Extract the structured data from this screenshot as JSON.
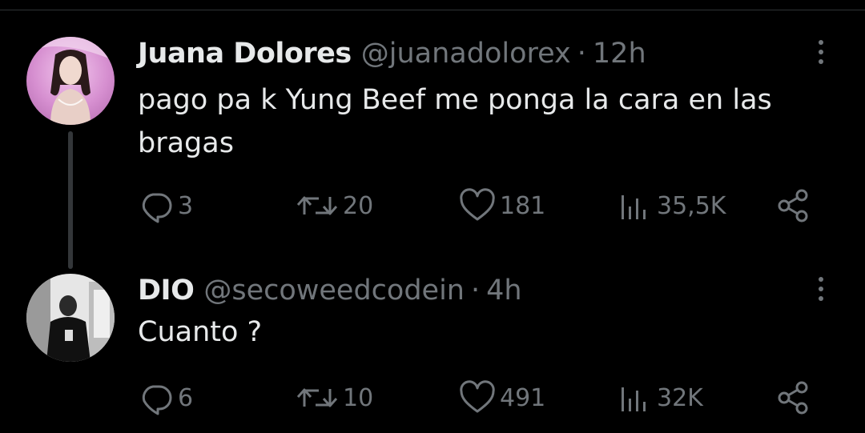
{
  "tweets": [
    {
      "name": "Juana Dolores",
      "handle": "@juanadolorex",
      "separator": "·",
      "time": "12h",
      "text": "pago pa k Yung Beef me ponga la cara en las bragas",
      "replies": "3",
      "retweets": "20",
      "likes": "181",
      "views": "35,5K",
      "avatar_color": "#d9a8d6"
    },
    {
      "name": "DIO",
      "handle": "@secoweedcodein",
      "separator": "·",
      "time": "4h",
      "text": "Cuanto ?",
      "replies": "6",
      "retweets": "10",
      "likes": "491",
      "views": "32K",
      "avatar_color": "#d0d0d0"
    }
  ],
  "icons": {
    "reply": "reply-icon",
    "retweet": "retweet-icon",
    "like": "heart-icon",
    "views": "views-icon",
    "share": "share-icon",
    "more": "more-icon"
  },
  "colors": {
    "background": "#000000",
    "primary_text": "#e7e9ea",
    "secondary_text": "#71767b",
    "thread_line": "#333639"
  }
}
